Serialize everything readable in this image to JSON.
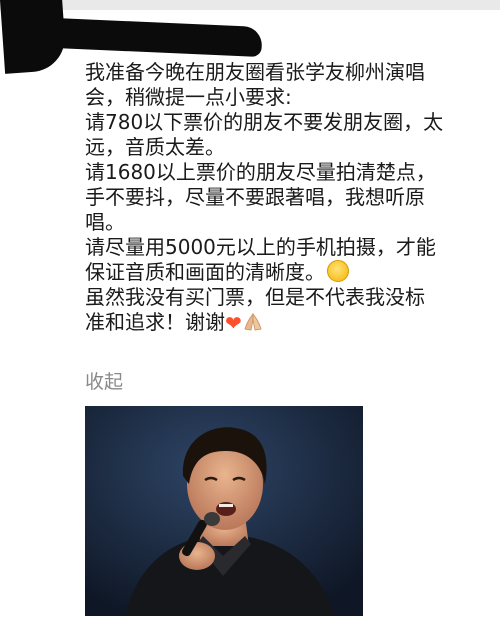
{
  "post": {
    "lines": [
      "我准备今晚在朋友圈看张学友柳州演唱",
      "会，稍微提一点小要求:",
      "请780以下票价的朋友不要发朋友圈，太",
      "远，音质太差。",
      "请1680以上票价的朋友尽量拍清楚点，",
      "手不要抖，尽量不要跟著唱，我想听原",
      "唱。",
      "请尽量用5000元以上的手机拍摄，才能",
      "保证音质和画面的清晰度。",
      "虽然我没有买门票，但是不代表我没标",
      "准和追求！谢谢"
    ],
    "emoji_after_line_9": "blushing-smile",
    "emoji_after_line_11": [
      "red-heart",
      "folded-hands"
    ]
  },
  "actions": {
    "collapse_label": "收起"
  },
  "photo": {
    "subject": "singer-with-microphone"
  }
}
